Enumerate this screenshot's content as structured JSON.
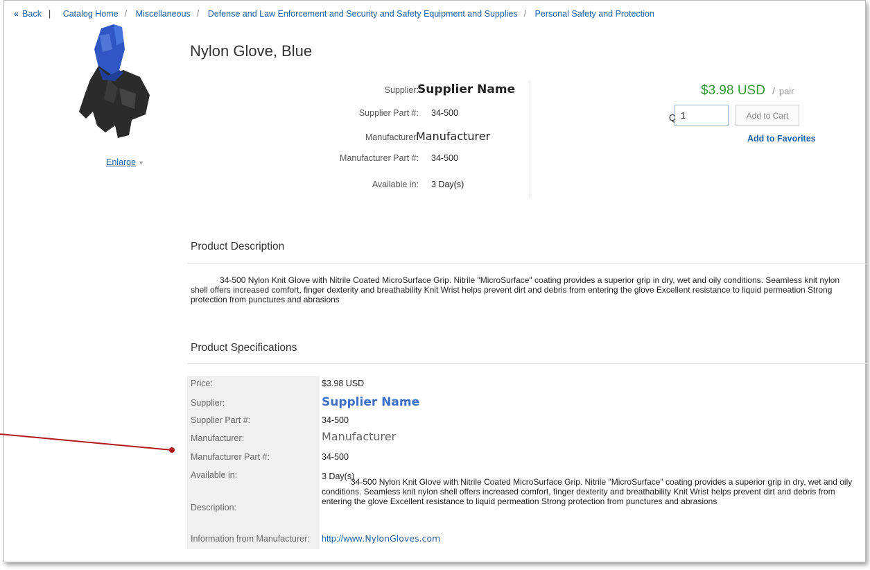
{
  "breadcrumb": {
    "back": "Back",
    "items": [
      "Catalog Home",
      "Miscellaneous",
      "Defense and Law Enforcement and Security and Safety Equipment and Supplies",
      "Personal Safety and Protection"
    ]
  },
  "product": {
    "title": "Nylon Glove, Blue",
    "enlarge_label": "Enlarge",
    "info": {
      "supplier_label": "Supplier:",
      "supplier_value": "Supplier Name",
      "supplier_part_label": "Supplier Part #:",
      "supplier_part_value": "34-500",
      "manufacturer_label": "Manufacturer:",
      "manufacturer_value": "Manufacturer",
      "manufacturer_part_label": "Manufacturer Part #:",
      "manufacturer_part_value": "34-500",
      "available_label": "Available in:",
      "available_value": "3 Day(s)"
    }
  },
  "purchase": {
    "price": "$3.98 USD",
    "slash": "/",
    "unit": "pair",
    "qty_label": "Qty:",
    "qty_value": "1",
    "add_to_cart": "Add to Cart",
    "add_to_favorites": "Add to Favorites"
  },
  "description": {
    "heading": "Product Description",
    "text": "34-500 Nylon Knit Glove with Nitrile Coated MicroSurface Grip. Nitrile \"MicroSurface\" coating provides a superior grip in dry, wet and oily conditions. Seamless knit nylon shell offers increased comfort, finger dexterity and breathability Knit Wrist helps prevent dirt and debris from entering the glove Excellent resistance to liquid permeation Strong protection from punctures and abrasions"
  },
  "specs": {
    "heading": "Product Specifications",
    "price_label": "Price:",
    "price_value": "$3.98 USD",
    "supplier_label": "Supplier:",
    "supplier_value": "Supplier Name",
    "supplier_part_label": "Supplier Part #:",
    "supplier_part_value": "34-500",
    "manufacturer_label": "Manufacturer:",
    "manufacturer_value": "Manufacturer",
    "manufacturer_part_label": "Manufacturer Part #:",
    "manufacturer_part_value": "34-500",
    "available_label": "Available in:",
    "available_value": "3 Day(s)",
    "description_label": "Description:",
    "description_value": "34-500 Nylon Knit Glove with Nitrile Coated MicroSurface Grip. Nitrile \"MicroSurface\" coating provides a superior grip in dry, wet and oily conditions. Seamless knit nylon shell offers increased comfort, finger dexterity and breathability Knit Wrist helps prevent dirt and debris from entering the glove Excellent resistance to liquid permeation Strong protection from punctures and abrasions",
    "info_label": "Information from Manufacturer:",
    "info_link_prefix": "http://www",
    "info_link_domain": ".NylonGloves.com"
  },
  "colors": {
    "link": "#1a5fa8",
    "price_green": "#3a9a3a",
    "annotation_red": "#b01c1c"
  }
}
